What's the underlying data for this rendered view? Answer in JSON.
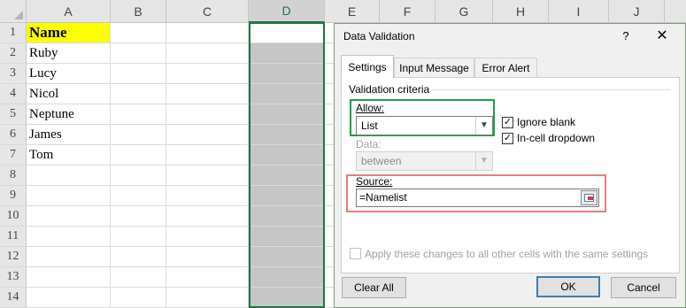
{
  "spreadsheet": {
    "columns": [
      "A",
      "B",
      "C",
      "D",
      "E",
      "F",
      "G",
      "H",
      "I",
      "J"
    ],
    "selected_column": "D",
    "rows": [
      "1",
      "2",
      "3",
      "4",
      "5",
      "6",
      "7",
      "8",
      "9",
      "10",
      "11",
      "12",
      "13",
      "14"
    ],
    "column_a_values": [
      "Name",
      "Ruby",
      "Lucy",
      "Nicol",
      "Neptune",
      "James",
      "Tom"
    ],
    "highlight_color": "#ffff00",
    "selection_color": "#217346"
  },
  "dialog": {
    "title": "Data Validation",
    "help_label": "?",
    "close_label": "✕",
    "tabs": [
      "Settings",
      "Input Message",
      "Error Alert"
    ],
    "active_tab": "Settings",
    "section_title": "Validation criteria",
    "allow": {
      "label": "Allow:",
      "value": "List"
    },
    "ignore_blank": {
      "label": "Ignore blank",
      "checked": true
    },
    "in_cell_dropdown": {
      "label": "In-cell dropdown",
      "checked": true
    },
    "data": {
      "label": "Data:",
      "value": "between",
      "disabled": true
    },
    "source": {
      "label": "Source:",
      "value": "=Namelist"
    },
    "apply_all": {
      "label": "Apply these changes to all other cells with the same settings",
      "checked": false,
      "disabled": true
    },
    "buttons": {
      "clear_all": "Clear All",
      "ok": "OK",
      "cancel": "Cancel"
    },
    "highlight_colors": {
      "allow_box": "#1e9e4a",
      "source_box": "#e57e7e"
    }
  }
}
